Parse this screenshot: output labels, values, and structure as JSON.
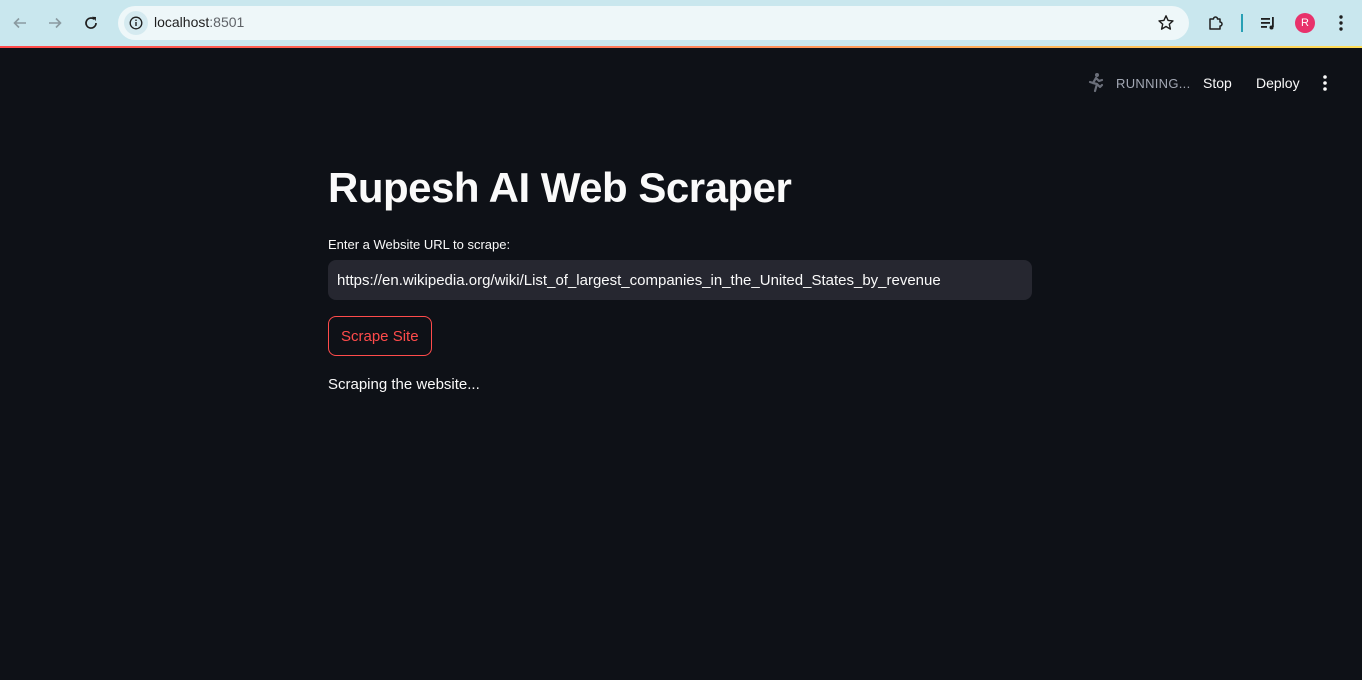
{
  "browser": {
    "url_host": "localhost",
    "url_port": ":8501",
    "profile_initial": "R",
    "icons": {
      "back": "arrow-left-icon",
      "forward": "arrow-right-icon",
      "reload": "reload-icon",
      "site_info": "info-icon",
      "bookmark": "star-icon",
      "extensions": "puzzle-icon",
      "media": "media-control-icon",
      "menu": "vertical-dots-icon"
    }
  },
  "toolbar": {
    "status": "RUNNING...",
    "stop_label": "Stop",
    "deploy_label": "Deploy",
    "icons": {
      "running": "running-man-icon",
      "main_menu": "vertical-dots-icon"
    }
  },
  "main": {
    "title": "Rupesh AI Web Scraper",
    "input_label": "Enter a Website URL to scrape:",
    "input_value": "https://en.wikipedia.org/wiki/List_of_largest_companies_in_the_United_States_by_revenue",
    "button_label": "Scrape Site",
    "status_message": "Scraping the website..."
  },
  "colors": {
    "background": "#0e1117",
    "primary": "#ff4b4b",
    "text": "#fafafa",
    "input_bg": "#262730",
    "chrome_bg": "#c9e7ee"
  }
}
